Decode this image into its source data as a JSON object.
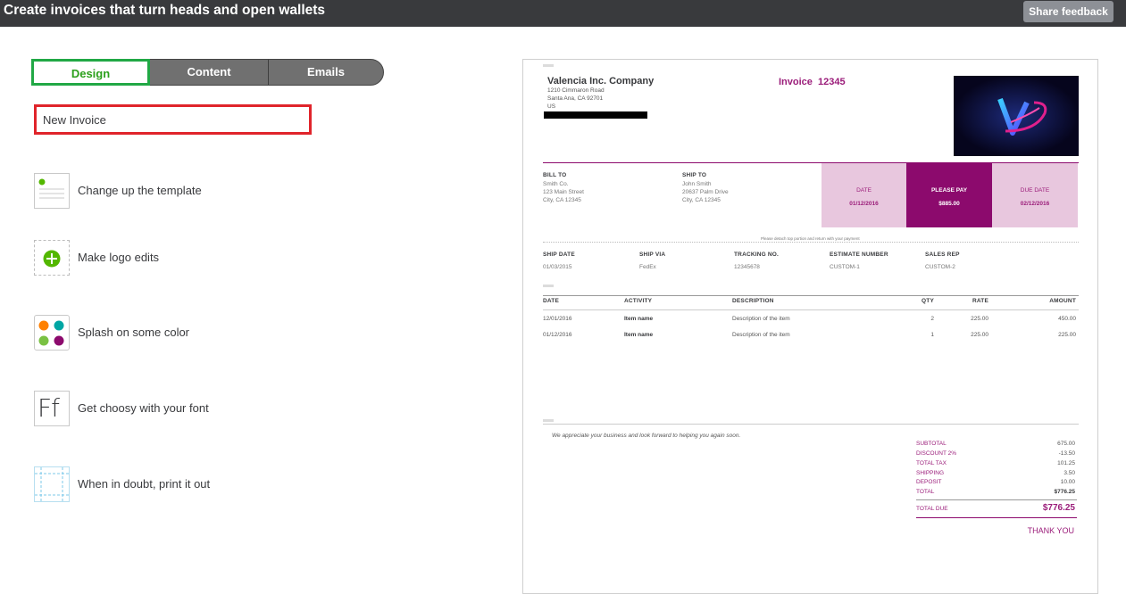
{
  "header": {
    "title": "Create invoices that turn heads and open wallets",
    "feedback_button": "Share feedback"
  },
  "tabs": [
    {
      "label": "Design"
    },
    {
      "label": "Content"
    },
    {
      "label": "Emails"
    }
  ],
  "template_name": {
    "value": "New Invoice"
  },
  "menu": [
    {
      "label": "Change up the template",
      "icon": "template-icon"
    },
    {
      "label": "Make logo edits",
      "icon": "logo-plus-icon"
    },
    {
      "label": "Splash on some color",
      "icon": "color-palette-icon"
    },
    {
      "label": "Get choosy with your font",
      "icon": "font-icon",
      "glyph": "Ff"
    },
    {
      "label": "When in doubt, print it out",
      "icon": "print-margins-icon"
    }
  ],
  "invoice": {
    "company_name": "Valencia Inc. Company",
    "address1": "1210 Cimmaron Road",
    "address2": "Santa Ana, CA 92701",
    "country": "US",
    "invoice_label": "Invoice",
    "invoice_number": "12345",
    "bill_to": {
      "heading": "BILL TO",
      "line1": "Smith Co.",
      "line2": "123 Main Street",
      "line3": "City, CA 12345"
    },
    "ship_to": {
      "heading": "SHIP TO",
      "line1": "John Smith",
      "line2": "20637 Palm Drive",
      "line3": "City, CA 12345"
    },
    "date": {
      "label": "DATE",
      "value": "01/12/2016"
    },
    "please_pay": {
      "label": "PLEASE PAY",
      "value": "$885.00"
    },
    "due_date": {
      "label": "DUE DATE",
      "value": "02/12/2016"
    },
    "detach_note": "Please detach top portion and return with your payment",
    "shipping": {
      "headers": [
        "SHIP DATE",
        "SHIP VIA",
        "TRACKING NO.",
        "ESTIMATE NUMBER",
        "SALES REP"
      ],
      "values": [
        "01/03/2015",
        "FedEx",
        "12345678",
        "CUSTOM-1",
        "CUSTOM-2"
      ]
    },
    "lines": {
      "headers": [
        "DATE",
        "ACTIVITY",
        "DESCRIPTION",
        "QTY",
        "RATE",
        "AMOUNT"
      ],
      "rows": [
        [
          "12/01/2016",
          "Item name",
          "Description of the item",
          "2",
          "225.00",
          "450.00"
        ],
        [
          "01/12/2016",
          "Item name",
          "Description of the item",
          "1",
          "225.00",
          "225.00"
        ]
      ]
    },
    "message": "We appreciate your business and look forward to helping you again soon.",
    "totals": [
      {
        "label": "SUBTOTAL",
        "value": "675.00"
      },
      {
        "label": "DISCOUNT 2%",
        "value": "-13.50"
      },
      {
        "label": "TOTAL TAX",
        "value": "101.25"
      },
      {
        "label": "SHIPPING",
        "value": "3.50"
      },
      {
        "label": "DEPOSIT",
        "value": "10.00"
      },
      {
        "label": "TOTAL",
        "value": "$776.25"
      }
    ],
    "total_due": {
      "label": "TOTAL DUE",
      "value": "$776.25"
    },
    "thank_you": "THANK YOU"
  },
  "colors": {
    "accent": "#8c0a6d",
    "accent_light": "#e8c7de",
    "tab_active": "#2ca01c",
    "highlight_red": "#e0242b"
  }
}
